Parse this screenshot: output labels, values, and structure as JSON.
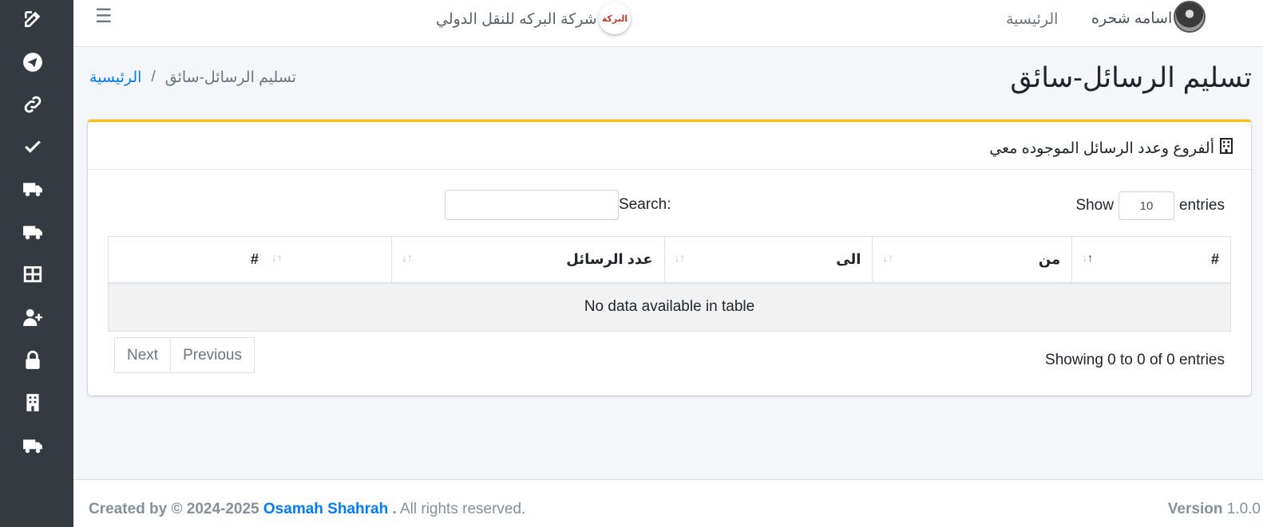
{
  "sidebar": {
    "items": [
      {
        "icon": "edit-icon"
      },
      {
        "icon": "telegram-icon"
      },
      {
        "icon": "link-icon"
      },
      {
        "icon": "check-icon"
      },
      {
        "icon": "truck-icon"
      },
      {
        "icon": "truck-icon"
      },
      {
        "icon": "table-icon"
      },
      {
        "icon": "user-plus-icon"
      },
      {
        "icon": "lock-icon"
      },
      {
        "icon": "building-icon"
      },
      {
        "icon": "truck-icon"
      }
    ]
  },
  "topbar": {
    "menu_icon": "☰",
    "brand_text": "شركة البركه للنقل الدولي",
    "logo_text": "البركة",
    "nav_home": "الرئيسية",
    "user_name": "اسامه شحره"
  },
  "page": {
    "title": "تسليم الرسائل-سائق",
    "breadcrumb": {
      "home": "الرئيسية",
      "separator": "/",
      "current": "تسليم الرسائل-سائق"
    }
  },
  "card": {
    "title": "ألفروع وعدد الرسائل الموجوده معي",
    "accent_color": "#ffc107",
    "length": {
      "show": "Show",
      "value": "10",
      "entries": "entries"
    },
    "search": {
      "label": "Search:",
      "value": ""
    },
    "table": {
      "columns": [
        "#",
        "من",
        "الى",
        "عدد الرسائل",
        "#"
      ],
      "empty_message": "No data available in table"
    },
    "info": "Showing 0 to 0 of 0 entries",
    "pagination": {
      "previous": "Previous",
      "next": "Next"
    }
  },
  "footer": {
    "created_by": "Created by © 2024-2025",
    "author": "Osamah Shahrah",
    "dot": ".",
    "rights": "All rights reserved.",
    "version_label": "Version",
    "version_value": "1.0.0"
  }
}
